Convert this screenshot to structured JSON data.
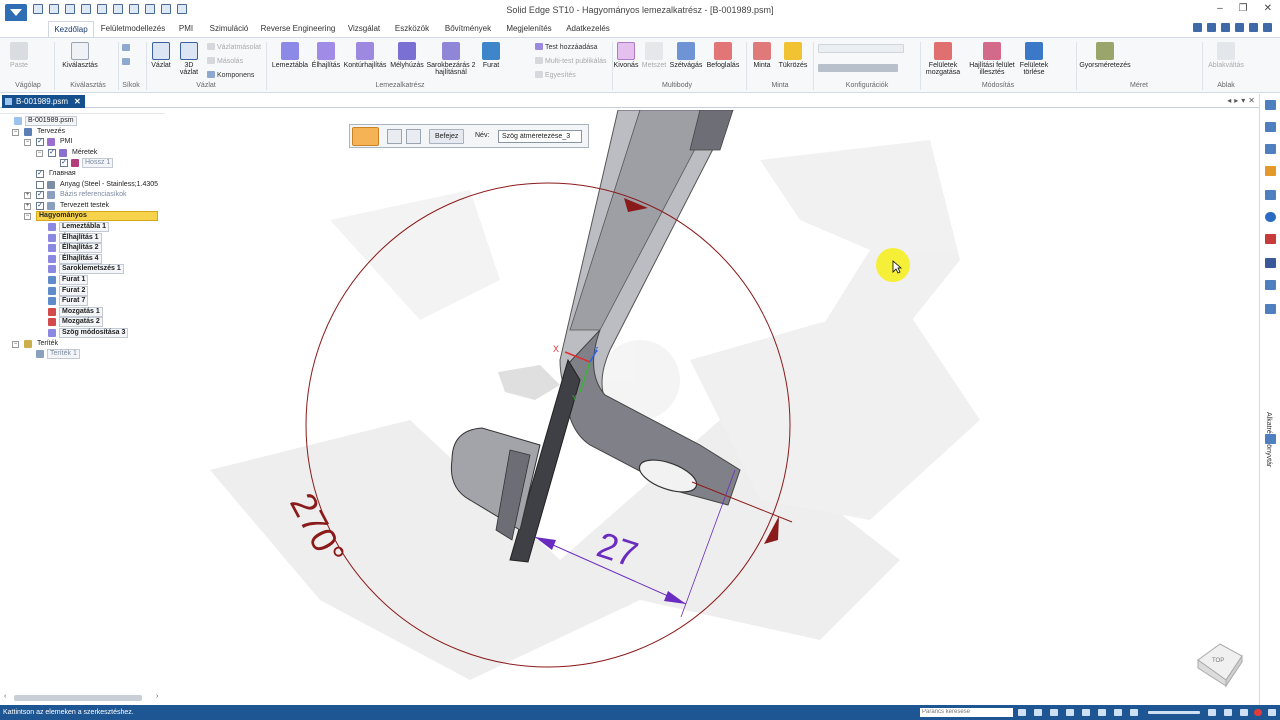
{
  "window": {
    "title": "Solid Edge ST10 - Hagyományos lemezalkatrész - [B-001989.psm]",
    "controls": [
      "‒",
      "❐",
      "✕"
    ]
  },
  "ribbon_tabs": [
    "Kezdőlap",
    "Felületmodellezés",
    "PMI",
    "Szimuláció",
    "Reverse Engineering",
    "Vizsgálat",
    "Eszközök",
    "Bővítmények",
    "Megjelenítés",
    "Adatkezelés"
  ],
  "ribbon": {
    "clipboard": {
      "paste": "Paste",
      "group": "Vágólap"
    },
    "select": {
      "select": "Kiválasztás",
      "group": "Kiválasztás"
    },
    "planes": {
      "group": "Síkok"
    },
    "sketch": {
      "sketch": "Vázlat",
      "sketch3d_l1": "3D",
      "sketch3d_l2": "vázlat",
      "projection": "Vázlatmásolat",
      "copy": "Másolás",
      "component": "Komponens",
      "group": "Vázlat"
    },
    "sheetmetal": {
      "tab": "Lemeztábla",
      "flange": "Élhajlítás",
      "contour": "Kontúrhajlítás",
      "deep": "Mélyhúzás",
      "corner_l1": "Sarokbezárás 2",
      "corner_l2": "hajlításnál",
      "hole": "Furat",
      "add_body": "Test hozzáadása",
      "multibody_publish": "Multi-test publikálás",
      "union": "Egyesítés",
      "group": "Lemezalkatrész"
    },
    "multibody": {
      "subtract": "Kivonás",
      "intersect": "Metszet",
      "split": "Szétvágás",
      "enclose": "Befoglalás",
      "group": "Multibody"
    },
    "pattern": {
      "pattern": "Minta",
      "mirror": "Tükrözés",
      "group": "Minta"
    },
    "config": {
      "group": "Konfigurációk"
    },
    "modify": {
      "move_l1": "Felületek",
      "move_l2": "mozgatása",
      "bend_l1": "Hajlítási felület",
      "bend_l2": "illesztés",
      "delete_l1": "Felületek",
      "delete_l2": "törlése",
      "group": "Módosítás"
    },
    "dimension": {
      "smart": "Gyorsméretezés",
      "group": "Méret"
    },
    "window": {
      "switch": "Ablakváltás",
      "group": "Ablak"
    }
  },
  "document_tab": {
    "name": "B-001989.psm",
    "close": "✕"
  },
  "command_bar": {
    "finish": "Befejez",
    "name_label": "Név:",
    "name_value": "Szög átméretezése_3"
  },
  "tree": [
    {
      "label": "B-001989.psm",
      "level": 0
    },
    {
      "label": "Tervezés",
      "level": 1
    },
    {
      "label": "PMI",
      "level": 2
    },
    {
      "label": "Méretek",
      "level": 3
    },
    {
      "label": "Hossz 1",
      "level": 4
    },
    {
      "label": "Главная",
      "level": 2
    },
    {
      "label": "Anyag (Steel - Stainless;1.4305",
      "level": 2
    },
    {
      "label": "Bázis referenciasíkok",
      "level": 2
    },
    {
      "label": "Tervezett testek",
      "level": 2
    },
    {
      "label": "Hagyományos",
      "level": 2
    },
    {
      "label": "Lemeztábla 1",
      "level": 3
    },
    {
      "label": "Élhajlítás 1",
      "level": 3
    },
    {
      "label": "Élhajlítás 2",
      "level": 3
    },
    {
      "label": "Élhajlítás 4",
      "level": 3
    },
    {
      "label": "Saroklemetszés 1",
      "level": 3
    },
    {
      "label": "Furat 1",
      "level": 3
    },
    {
      "label": "Furat 2",
      "level": 3
    },
    {
      "label": "Furat 7",
      "level": 3
    },
    {
      "label": "Mozgatás 1",
      "level": 3
    },
    {
      "label": "Mozgatás 2",
      "level": 3
    },
    {
      "label": "Szög módosítása 3",
      "level": 3
    },
    {
      "label": "Teríték",
      "level": 1
    },
    {
      "label": "Teríték 1",
      "level": 2
    }
  ],
  "viewport": {
    "angle_dimension": "270°",
    "linear_dimension": "27",
    "axis_x": "X",
    "axis_y": "Y",
    "axis_z": "Z",
    "viewcube": "TOP",
    "colors": {
      "dimension_red": "#8b1a1a",
      "dimension_purple": "#6a2cc0",
      "part_gray": "#8e8f95"
    }
  },
  "right_panel": {
    "library_label": "Alkatrészkönyvtár"
  },
  "status": {
    "message": "Kattintson az elemeken a szerkesztéshez.",
    "search_placeholder": "Parancs keresése"
  }
}
